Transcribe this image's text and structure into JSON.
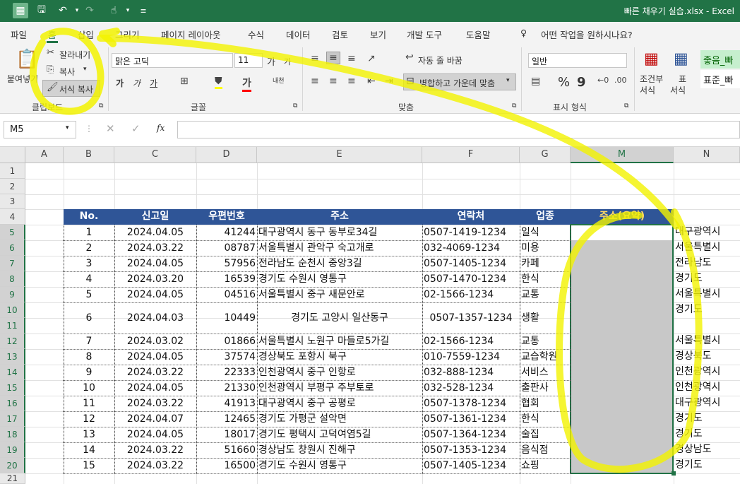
{
  "title": "빠른 채우기 실습.xlsx - Excel",
  "menu": [
    "파일",
    "홈",
    "삽입",
    "그리기",
    "페이지 레이아웃",
    "수식",
    "데이터",
    "검토",
    "보기",
    "개발 도구",
    "도움말"
  ],
  "tell_me": "어떤 작업을 원하시나요?",
  "clipboard": {
    "paste": "붙여넣기",
    "cut": "잘라내기",
    "copy": "복사",
    "format_painter": "서식 복사",
    "label": "클립보드"
  },
  "font": {
    "name": "맑은 고딕",
    "size": "11",
    "label": "글꼴",
    "grow": "가",
    "shrink": "가",
    "bold": "가",
    "italic": "가",
    "underline": "가",
    "phonetic": "내천"
  },
  "align": {
    "wrap": "자동 줄 바꿈",
    "merge": "병합하고 가운데 맞춤",
    "label": "맞춤"
  },
  "number": {
    "format": "일반",
    "label": "표시 형식",
    "percent": "%",
    "comma": "9"
  },
  "styles": {
    "cond": "조건부",
    "cond2": "서식",
    "table": "표",
    "table2": "서식",
    "good": "좋음_빠",
    "normal": "표준_빠"
  },
  "namebox": "M5",
  "fx": "fx",
  "columns": [
    "A",
    "B",
    "C",
    "D",
    "E",
    "F",
    "G",
    "M",
    "N"
  ],
  "rows": [
    "1",
    "2",
    "3",
    "4",
    "5",
    "6",
    "7",
    "8",
    "9",
    "10",
    "11",
    "12",
    "13",
    "14",
    "15",
    "16",
    "17",
    "18",
    "19",
    "20",
    "21"
  ],
  "table_headers": [
    "No.",
    "신고일",
    "우편번호",
    "주소",
    "연락처",
    "업종",
    "주소(요약)"
  ],
  "table_rows": [
    {
      "no": "1",
      "date": "2024.04.05",
      "zip": "41244",
      "addr": "대구광역시 동구 동부로34길",
      "tel": "0507-1419-1234",
      "biz": "일식",
      "n": "대구광역시"
    },
    {
      "no": "2",
      "date": "2024.03.22",
      "zip": "08787",
      "addr": "서울특별시 관악구 숙고개로",
      "tel": "032-4069-1234",
      "biz": "미용",
      "n": "서울특별시"
    },
    {
      "no": "3",
      "date": "2024.04.05",
      "zip": "57956",
      "addr": "전라남도 순천시 중앙3길",
      "tel": "0507-1405-1234",
      "biz": "카페",
      "n": "전라남도"
    },
    {
      "no": "4",
      "date": "2024.03.20",
      "zip": "16539",
      "addr": "경기도 수원시 영통구",
      "tel": "0507-1470-1234",
      "biz": "한식",
      "n": "경기도"
    },
    {
      "no": "5",
      "date": "2024.04.05",
      "zip": "04516",
      "addr": "서울특별시 중구 새문안로",
      "tel": "02-1566-1234",
      "biz": "교통",
      "n": "서울특별시"
    },
    {
      "no": "6",
      "date": "2024.04.03",
      "zip": "10449",
      "addr": "경기도 고양시 일산동구",
      "tel": "0507-1357-1234",
      "biz": "생활",
      "n": "경기도"
    },
    {
      "no": "7",
      "date": "2024.03.02",
      "zip": "01866",
      "addr": "서울특별시 노원구 마들로5가길",
      "tel": "02-1566-1234",
      "biz": "교통",
      "n": "서울특별시"
    },
    {
      "no": "8",
      "date": "2024.04.05",
      "zip": "37574",
      "addr": "경상북도 포항시 북구",
      "tel": "010-7559-1234",
      "biz": "교습학원",
      "n": "경상북도"
    },
    {
      "no": "9",
      "date": "2024.03.22",
      "zip": "22333",
      "addr": "인천광역시 중구 인항로",
      "tel": "032-888-1234",
      "biz": "서비스",
      "n": "인천광역시"
    },
    {
      "no": "10",
      "date": "2024.04.05",
      "zip": "21330",
      "addr": "인천광역시 부평구 주부토로",
      "tel": "032-528-1234",
      "biz": "출판사",
      "n": "인천광역시"
    },
    {
      "no": "11",
      "date": "2024.03.22",
      "zip": "41913",
      "addr": "대구광역시 중구 공평로",
      "tel": "0507-1378-1234",
      "biz": "협회",
      "n": "대구광역시"
    },
    {
      "no": "12",
      "date": "2024.04.07",
      "zip": "12465",
      "addr": "경기도 가평군 설악면",
      "tel": "0507-1361-1234",
      "biz": "한식",
      "n": "경기도"
    },
    {
      "no": "13",
      "date": "2024.04.05",
      "zip": "18017",
      "addr": "경기도 평택시 고덕여염5길",
      "tel": "0507-1364-1234",
      "biz": "술집",
      "n": "경기도"
    },
    {
      "no": "14",
      "date": "2024.03.22",
      "zip": "51660",
      "addr": "경상남도 창원시 진해구",
      "tel": "0507-1353-1234",
      "biz": "음식점",
      "n": "경상남도"
    },
    {
      "no": "15",
      "date": "2024.03.22",
      "zip": "16500",
      "addr": "경기도 수원시 영통구",
      "tel": "0507-1405-1234",
      "biz": "쇼핑",
      "n": "경기도"
    }
  ],
  "colors": {
    "excel_green": "#217346",
    "header_blue": "#2f5597",
    "highlight": "#f2f200"
  }
}
